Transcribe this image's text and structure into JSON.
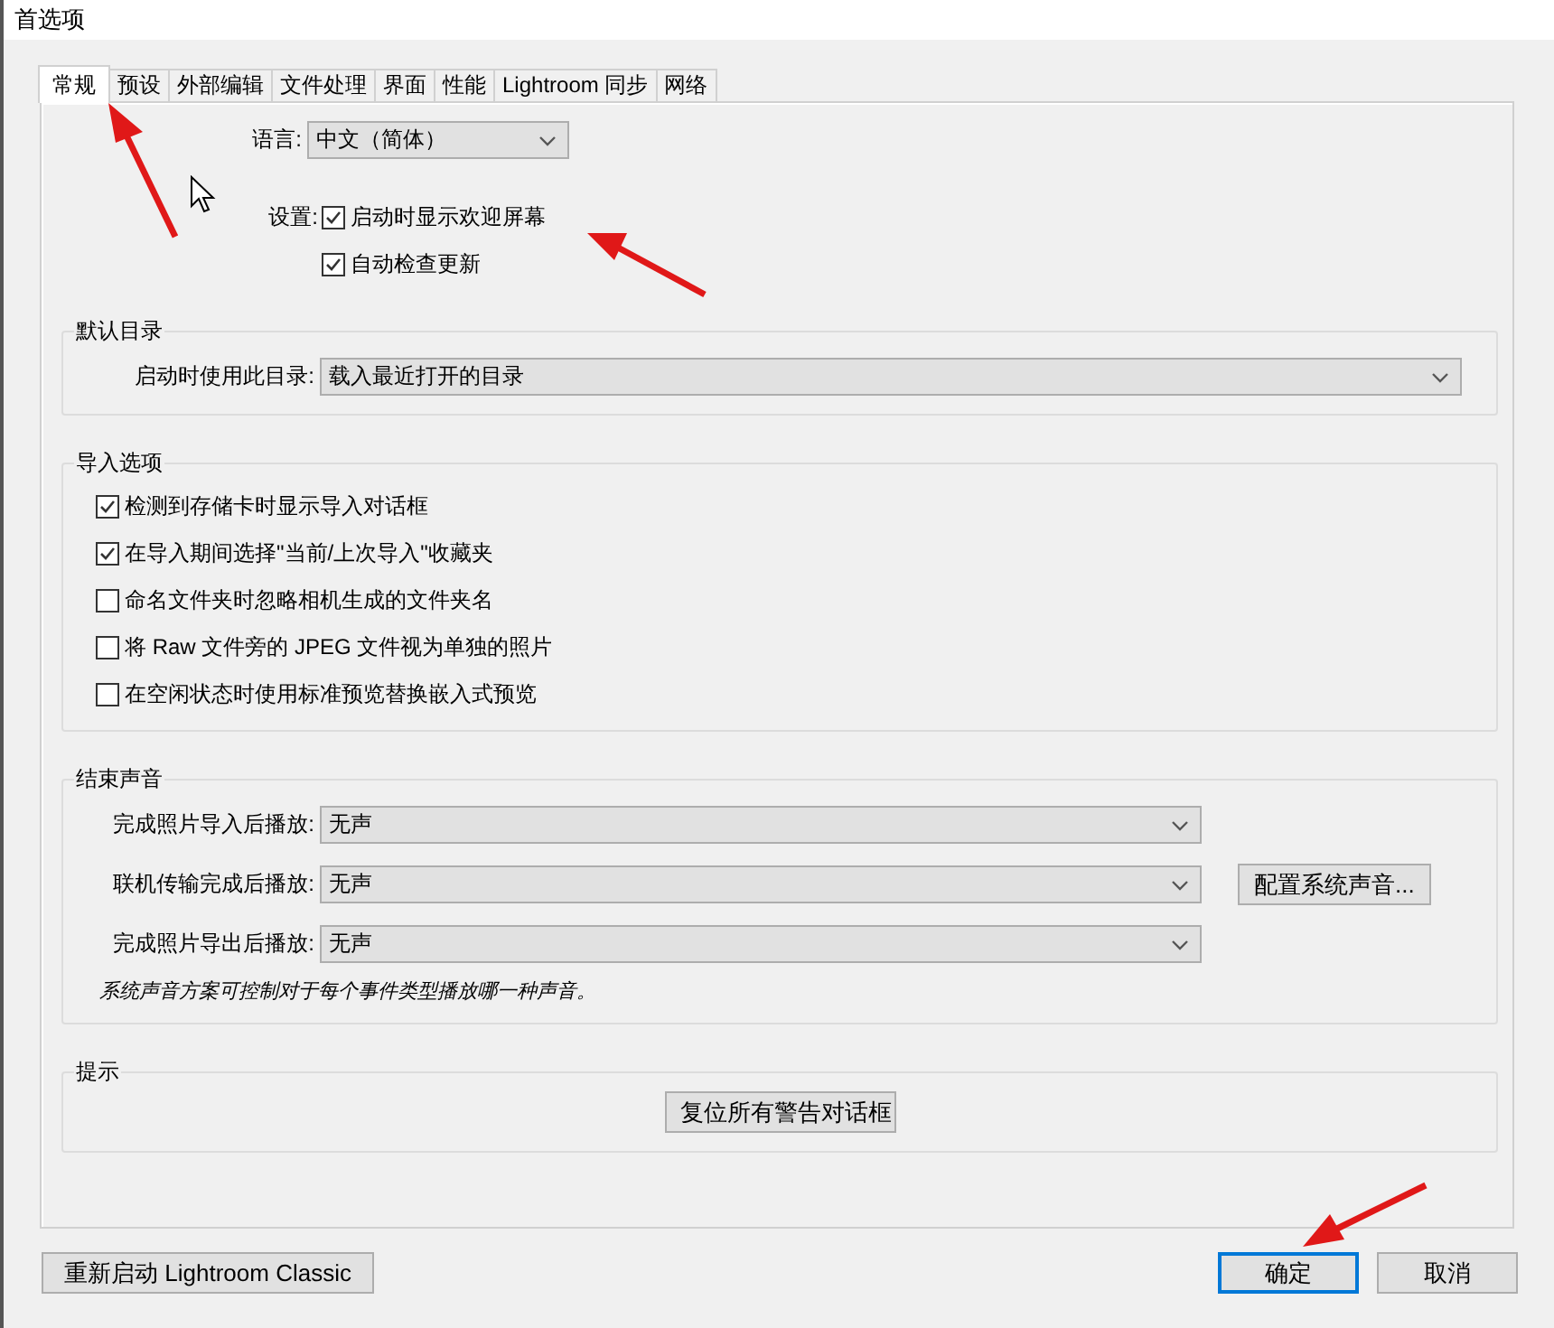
{
  "window": {
    "title": "首选项"
  },
  "tabs": [
    {
      "label": "常规",
      "selected": true
    },
    {
      "label": "预设",
      "selected": false
    },
    {
      "label": "外部编辑",
      "selected": false
    },
    {
      "label": "文件处理",
      "selected": false
    },
    {
      "label": "界面",
      "selected": false
    },
    {
      "label": "性能",
      "selected": false
    },
    {
      "label": "Lightroom 同步",
      "selected": false
    },
    {
      "label": "网络",
      "selected": false
    }
  ],
  "general": {
    "language_label": "语言:",
    "language_value": "中文（简体）",
    "settings_label": "设置:",
    "settings": [
      {
        "label": "启动时显示欢迎屏幕",
        "checked": true
      },
      {
        "label": "自动检查更新",
        "checked": true
      }
    ]
  },
  "default_catalog": {
    "title": "默认目录",
    "label": "启动时使用此目录:",
    "value": "载入最近打开的目录"
  },
  "import_options": {
    "title": "导入选项",
    "items": [
      {
        "label": "检测到存储卡时显示导入对话框",
        "checked": true
      },
      {
        "label": "在导入期间选择\"当前/上次导入\"收藏夹",
        "checked": true
      },
      {
        "label": "命名文件夹时忽略相机生成的文件夹名",
        "checked": false
      },
      {
        "label": "将 Raw 文件旁的 JPEG 文件视为单独的照片",
        "checked": false
      },
      {
        "label": "在空闲状态时使用标准预览替换嵌入式预览",
        "checked": false
      }
    ]
  },
  "completion_sounds": {
    "title": "结束声音",
    "rows": [
      {
        "label": "完成照片导入后播放:",
        "value": "无声"
      },
      {
        "label": "联机传输完成后播放:",
        "value": "无声"
      },
      {
        "label": "完成照片导出后播放:",
        "value": "无声"
      }
    ],
    "configure_button": "配置系统声音...",
    "note": "系统声音方案可控制对于每个事件类型播放哪一种声音。"
  },
  "prompts": {
    "title": "提示",
    "button": "复位所有警告对话框"
  },
  "footer": {
    "restart_button": "重新启动 Lightroom Classic",
    "ok_button": "确定",
    "cancel_button": "取消"
  }
}
